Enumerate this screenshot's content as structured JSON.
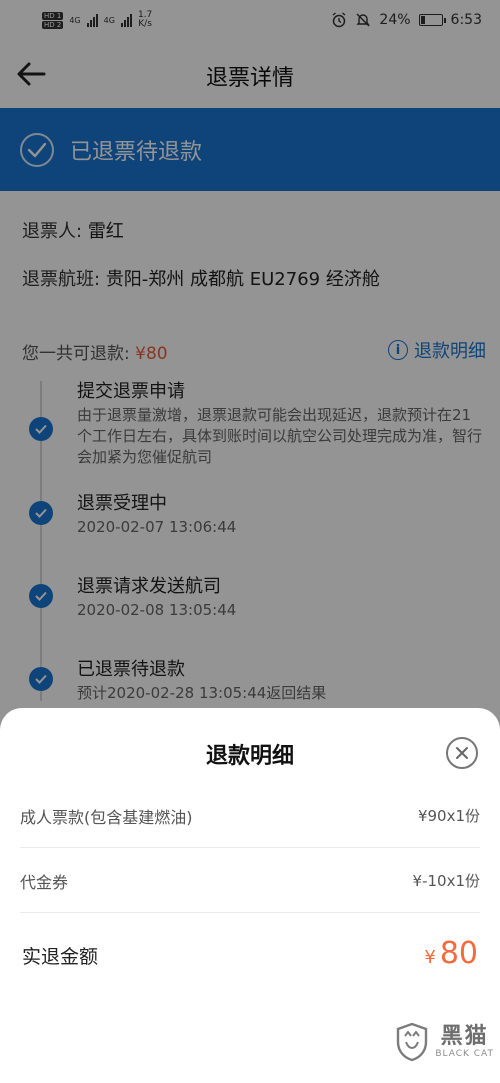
{
  "status_bar": {
    "hd1": "HD 1",
    "hd2": "HD 2",
    "net1": "4G",
    "net2": "4G",
    "speed_value": "1.7",
    "speed_unit": "K/s",
    "battery_pct": "24%",
    "battery_level": 0.24,
    "time": "6:53",
    "icons": [
      "alarm-icon",
      "mute-icon",
      "battery-icon"
    ]
  },
  "header": {
    "title": "退票详情",
    "back_icon": "back-arrow-icon"
  },
  "banner": {
    "status_text": "已退票待退款",
    "icon": "check-circle-icon",
    "color": "#1976d2"
  },
  "info": {
    "passenger_label": "退票人:",
    "passenger_name": "雷红",
    "flight_label": "退票航班:",
    "flight_detail": "贵阳-郑州 成都航 EU2769 经济舱"
  },
  "refund": {
    "total_label": "您一共可退款:",
    "total_amount": "¥80",
    "detail_link": "退款明细"
  },
  "timeline": [
    {
      "title": "提交退票申请",
      "desc": "由于退票量激增，退票退款可能会出现延迟，退款预计在21个工作日左右，具体到账时间以航空公司处理完成为准，智行会加紧为您催促航司"
    },
    {
      "title": "退票受理中",
      "desc": "2020-02-07 13:06:44"
    },
    {
      "title": "退票请求发送航司",
      "desc": "2020-02-08 13:05:44"
    },
    {
      "title": "已退票待退款",
      "desc": "预计2020-02-28 13:05:44返回结果"
    }
  ],
  "sheet": {
    "title": "退款明细",
    "close_icon": "close-circle-icon",
    "rows": [
      {
        "label": "成人票款(包含基建燃油)",
        "value": "¥90x1份"
      },
      {
        "label": "代金券",
        "value": "¥-10x1份"
      }
    ],
    "total_label": "实退金额",
    "total_currency": "¥",
    "total_value": "80"
  },
  "watermark": {
    "cn": "黑猫",
    "en": "BLACK CAT"
  }
}
